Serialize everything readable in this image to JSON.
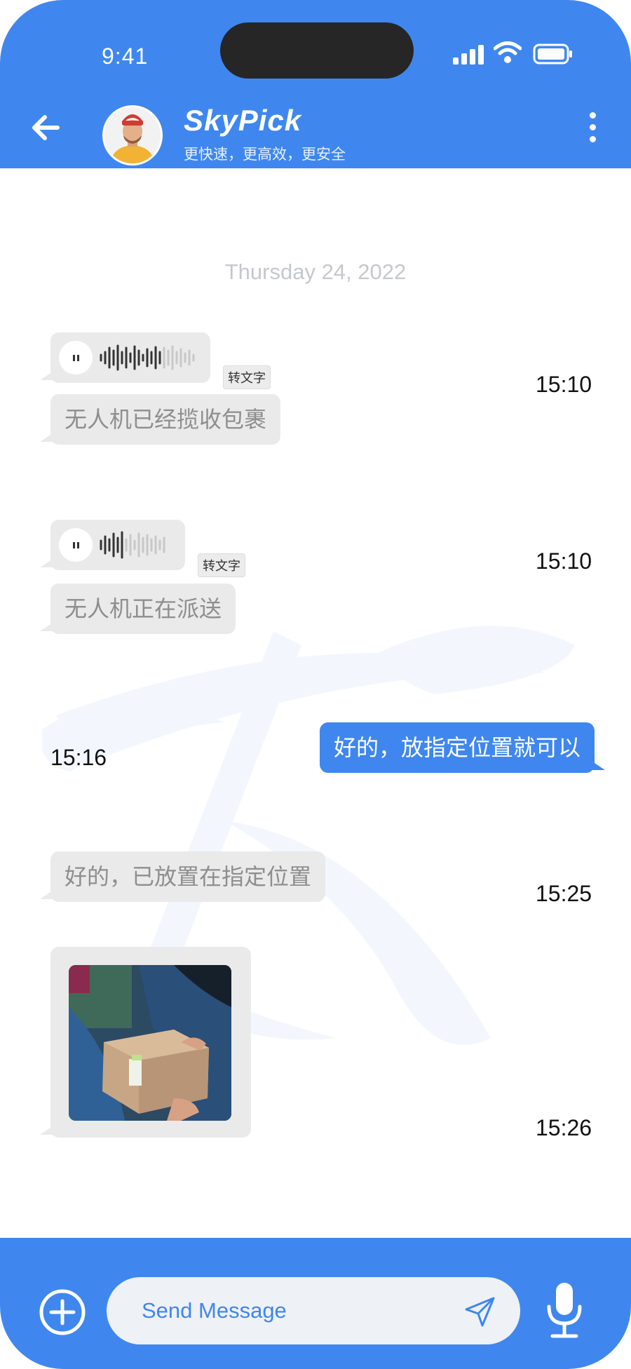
{
  "status_bar": {
    "time": "9:41"
  },
  "header": {
    "title": "SkyPick",
    "subtitle": "更快速，更高效，更安全"
  },
  "chat": {
    "date_separator": "Thursday 24, 2022",
    "messages": [
      {
        "type": "voice",
        "direction": "incoming",
        "convert_label": "转文字",
        "time": "15:10",
        "transcript": "无人机已经揽收包裹"
      },
      {
        "type": "voice",
        "direction": "incoming",
        "convert_label": "转文字",
        "time": "15:10",
        "transcript": "无人机正在派送"
      },
      {
        "type": "text",
        "direction": "outgoing",
        "text": "好的，放指定位置就可以",
        "time": "15:16"
      },
      {
        "type": "text",
        "direction": "incoming",
        "text": "好的，已放置在指定位置",
        "time": "15:25"
      },
      {
        "type": "image",
        "direction": "incoming",
        "time": "15:26"
      }
    ]
  },
  "composer": {
    "placeholder": "Send Message"
  },
  "colors": {
    "brand": "#3f87ee",
    "incoming_bubble": "#eaeaea",
    "outgoing_bubble": "#3f87ee"
  },
  "icons": [
    "back-arrow-icon",
    "more-vertical-icon",
    "play-icon",
    "add-icon",
    "send-icon",
    "microphone-icon"
  ]
}
